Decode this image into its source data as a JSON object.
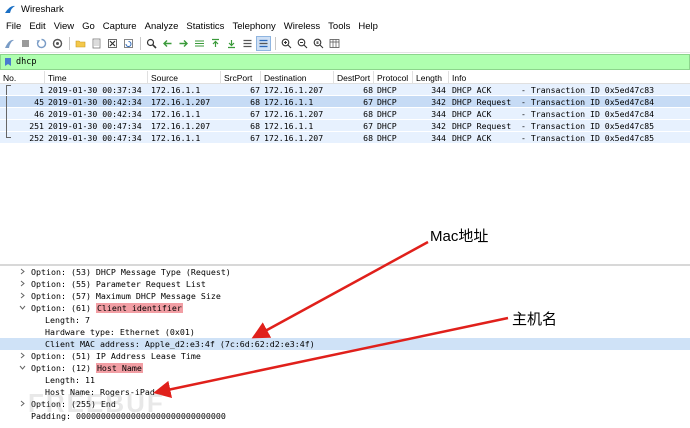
{
  "window": {
    "title": "Wireshark"
  },
  "menu": [
    "File",
    "Edit",
    "View",
    "Go",
    "Capture",
    "Analyze",
    "Statistics",
    "Telephony",
    "Wireless",
    "Tools",
    "Help"
  ],
  "filter": {
    "value": "dhcp"
  },
  "columns": [
    "No.",
    "Time",
    "Source",
    "SrcPort",
    "Destination",
    "DestPort",
    "Protocol",
    "Length",
    "Info"
  ],
  "packets": [
    {
      "no": "1",
      "time": "2019-01-30 00:37:34",
      "src": "172.16.1.1",
      "sport": "67",
      "dst": "172.16.1.207",
      "dport": "68",
      "proto": "DHCP",
      "len": "344",
      "info": "DHCP ACK      - Transaction ID 0x5ed47c83"
    },
    {
      "no": "45",
      "time": "2019-01-30 00:42:34",
      "src": "172.16.1.207",
      "sport": "68",
      "dst": "172.16.1.1",
      "dport": "67",
      "proto": "DHCP",
      "len": "342",
      "info": "DHCP Request  - Transaction ID 0x5ed47c84"
    },
    {
      "no": "46",
      "time": "2019-01-30 00:42:34",
      "src": "172.16.1.1",
      "sport": "67",
      "dst": "172.16.1.207",
      "dport": "68",
      "proto": "DHCP",
      "len": "344",
      "info": "DHCP ACK      - Transaction ID 0x5ed47c84"
    },
    {
      "no": "251",
      "time": "2019-01-30 00:47:34",
      "src": "172.16.1.207",
      "sport": "68",
      "dst": "172.16.1.1",
      "dport": "67",
      "proto": "DHCP",
      "len": "342",
      "info": "DHCP Request  - Transaction ID 0x5ed47c85"
    },
    {
      "no": "252",
      "time": "2019-01-30 00:47:34",
      "src": "172.16.1.1",
      "sport": "67",
      "dst": "172.16.1.207",
      "dport": "68",
      "proto": "DHCP",
      "len": "344",
      "info": "DHCP ACK      - Transaction ID 0x5ed47c85"
    }
  ],
  "details": {
    "opt53": "Option: (53) DHCP Message Type (Request)",
    "opt55": "Option: (55) Parameter Request List",
    "opt57": "Option: (57) Maximum DHCP Message Size",
    "opt61_prefix": "Option: (61) ",
    "opt61_tag": "Client identifier",
    "opt61_len": "Length: 7",
    "opt61_hw": "Hardware type: Ethernet (0x01)",
    "opt61_mac": "Client MAC address: Apple_d2:e3:4f (7c:6d:62:d2:e3:4f)",
    "opt51": "Option: (51) IP Address Lease Time",
    "opt12_prefix": "Option: (12) ",
    "opt12_tag": "Host Name",
    "opt12_len": "Length: 11",
    "opt12_host": "Host Name: Rogers-iPad",
    "opt255": "Option: (255) End",
    "padding": "Padding: 000000000000000000000000000000"
  },
  "annotations": {
    "mac": "Mac地址",
    "host": "主机名"
  },
  "colors": {
    "filter_bg": "#afffaf",
    "row_bg": "#e7f1fe",
    "tag_bg": "#f29ea4",
    "arrow": "#e0201b"
  }
}
